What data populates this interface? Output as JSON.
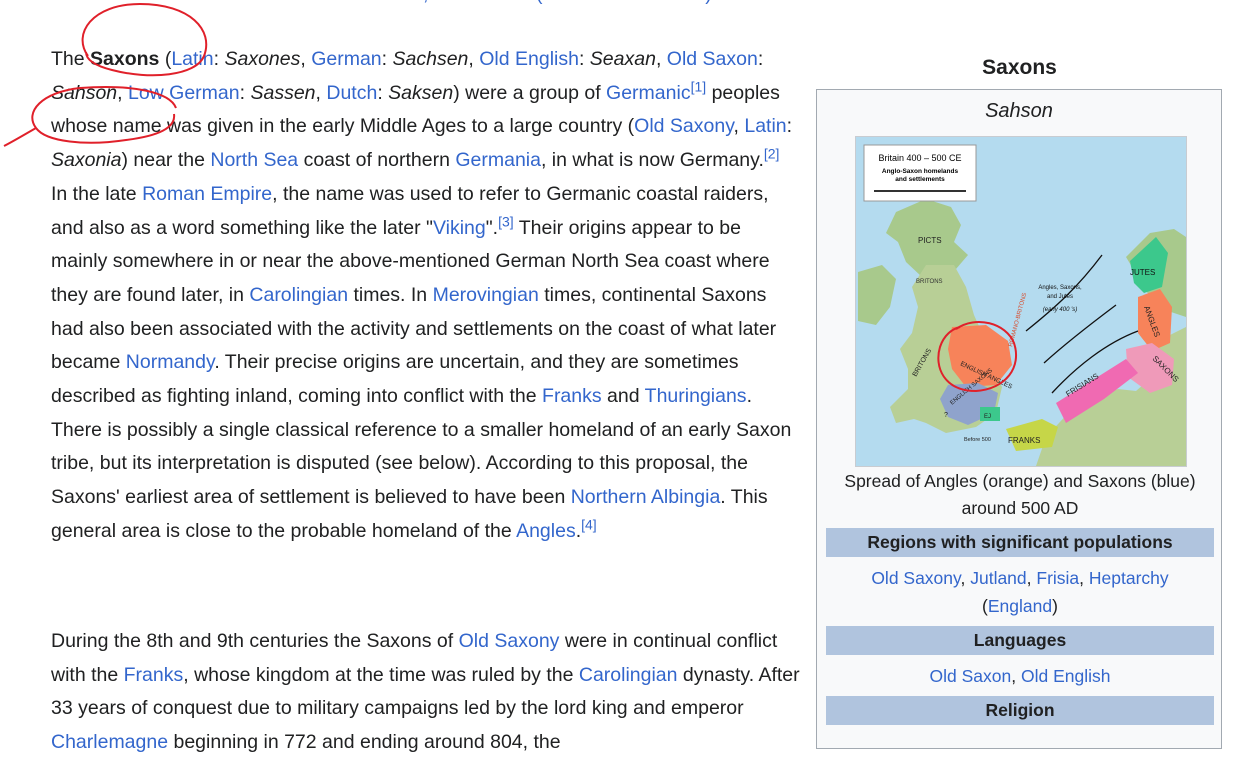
{
  "article": {
    "top_cut_text": ", ─────── (───── ───── ─)",
    "p1": {
      "t01": "The ",
      "subject": "Saxons",
      "t02": " (",
      "l_latin": "Latin",
      "t03": ": ",
      "i_saxones": "Saxones",
      "t04": ", ",
      "l_german": "German",
      "t05": ": ",
      "i_sachsen": "Sachsen",
      "t06": ", ",
      "l_oldenglish": "Old English",
      "t07": ": ",
      "i_seaxan": "Seaxan",
      "t08": ", ",
      "l_oldsaxon": "Old Saxon",
      "t09": ": ",
      "i_sahson": "Sahson",
      "t10": ", ",
      "l_lowgerman": "Low German",
      "t11": ": ",
      "i_sassen": "Sassen",
      "t12": ", ",
      "l_dutch": "Dutch",
      "t13": ": ",
      "i_saksen": "Saksen",
      "t14": ") were a group of ",
      "l_germanic": "Germanic",
      "ref1": "[1]",
      "t15": " peoples whose name was given in the early Middle Ages to a large country (",
      "l_oldsaxony": "Old Saxony",
      "t16": ", ",
      "l_latin2": "Latin",
      "t17": ": ",
      "i_saxonia": "Saxonia",
      "t18": ") near the ",
      "l_northsea": "North Sea",
      "t19": " coast of northern ",
      "l_germania": "Germania",
      "t20": ", in what is now Germany.",
      "ref2": "[2]",
      "t21": " In the late ",
      "l_romanempire": "Roman Empire",
      "t22": ", the name was used to refer to Germanic coastal raiders, and also as a word something like the later \"",
      "l_viking": "Viking",
      "t23": "\".",
      "ref3": "[3]",
      "t24": " Their origins appear to be mainly somewhere in or near the above-mentioned German North Sea coast where they are found later, in ",
      "l_carolingian": "Carolingian",
      "t25": " times. In ",
      "l_merovingian": "Merovingian",
      "t26": " times, continental Saxons had also been associated with the activity and settlements on the coast of what later became ",
      "l_normandy": "Normandy",
      "t27": ". Their precise origins are uncertain, and they are sometimes described as fighting inland, coming into conflict with the ",
      "l_franks": "Franks",
      "t28": " and ",
      "l_thuringians": "Thuringians",
      "t29": ". There is possibly a single classical reference to a smaller homeland of an early Saxon tribe, but its interpretation is disputed (see below). According to this proposal, the Saxons' earliest area of settlement is believed to have been ",
      "l_northernalbingia": "Northern Albingia",
      "t30": ". This general area is close to the probable homeland of the ",
      "l_angles": "Angles",
      "t31": ".",
      "ref4": "[4]"
    },
    "p2": {
      "t01": "During the 8th and 9th centuries the Saxons of ",
      "l_oldsaxony": "Old Saxony",
      "t02": " were in continual conflict with the ",
      "l_franks": "Franks",
      "t03": ", whose kingdom at the time was ruled by the ",
      "l_carolingian": "Carolingian",
      "t04": " dynasty. After 33 years of conquest due to military campaigns led by the lord king and emperor ",
      "l_charlemagne": "Charlemagne",
      "t05": " beginning in 772 and ending around 804, the"
    }
  },
  "infobox": {
    "title": "Saxons",
    "native_name": "Sahson",
    "map": {
      "legend_title": "Britain 400 – 500 CE",
      "legend_sub1": "Anglo-Saxon homelands",
      "legend_sub2": "and settlements",
      "labels": {
        "picts": "PICTS",
        "britons": "BRITONS",
        "britons2": "BRITONS",
        "jutes": "JUTES",
        "angles": "ANGLES",
        "saxons": "SAXONS",
        "frisians": "FRISIANS",
        "franks": "FRANKS",
        "english_angles": "ENGLISH ANGLES",
        "english_saxons": "ENGLISH SAXONS",
        "ej": "EJ",
        "romano": "ROMANO-BRITONS",
        "britons_west": "BRITONS",
        "arrow_note1": "Angles, Saxons,",
        "arrow_note2": "and Jutes",
        "arrow_note3": "(early 400 's)",
        "before500": "Before 500",
        "q": "?"
      }
    },
    "caption": "Spread of Angles (orange) and Saxons (blue) around 500 AD",
    "regions_header": "Regions with significant populations",
    "regions": {
      "oldsaxony": "Old Saxony",
      "sep1": ", ",
      "jutland": "Jutland",
      "sep2": ", ",
      "frisia": "Frisia",
      "sep3": ", ",
      "heptarchy": "Heptarchy",
      "open": " (",
      "england": "England",
      "close": ")"
    },
    "languages_header": "Languages",
    "languages": {
      "oldsaxon": "Old Saxon",
      "sep": ", ",
      "oldenglish": "Old English"
    },
    "religion_header": "Religion"
  },
  "colors": {
    "link": "#3366cc",
    "text": "#202122",
    "infobox_header": "#b0c4de",
    "annotation_red": "#e0202a",
    "sea": "#b4dbef",
    "angles_orange": "#f7835a",
    "saxons_pink": "#ef9ab9",
    "frisians_pink": "#f06ab2",
    "jutes_green": "#3cc88c",
    "franks_yellow": "#c6d648",
    "english_saxons_blue": "#8fa3cc"
  }
}
